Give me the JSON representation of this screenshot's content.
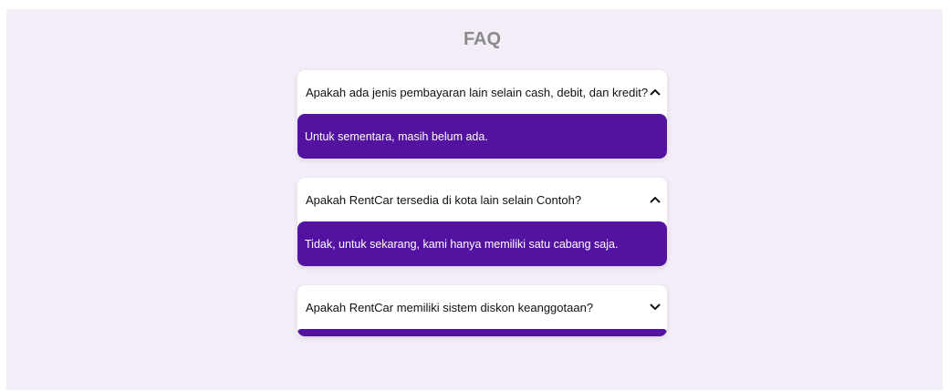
{
  "faq": {
    "title": "FAQ",
    "items": [
      {
        "question": "Apakah ada jenis pembayaran lain selain cash, debit, dan kredit?",
        "answer": "Untuk sementara, masih belum ada.",
        "chevron": "chevron-up-icon"
      },
      {
        "question": "Apakah RentCar tersedia di kota lain selain Contoh?",
        "answer": "Tidak, untuk sekarang, kami hanya memiliki satu cabang saja.",
        "chevron": "chevron-up-icon"
      },
      {
        "question": "Apakah RentCar memiliki sistem diskon keanggotaan?",
        "answer": "",
        "chevron": "chevron-down-icon"
      }
    ]
  },
  "colors": {
    "background": "#f3edf8",
    "answer_bg": "#5412a0",
    "title": "#8a8a8a"
  }
}
